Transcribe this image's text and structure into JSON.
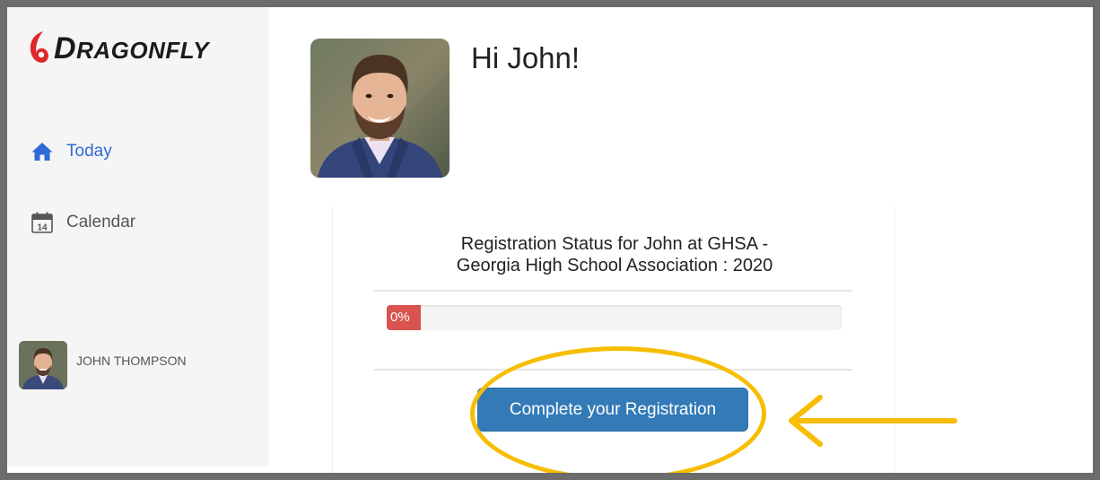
{
  "brand": {
    "logo_text_first": "D",
    "logo_text_rest": "RAGONFLY",
    "accent_color": "#e0262a"
  },
  "sidebar": {
    "items": [
      {
        "label": "Today",
        "icon": "home-icon",
        "active": true,
        "color": "#2f6ad9"
      },
      {
        "label": "Calendar",
        "icon": "calendar-icon",
        "icon_text": "14",
        "active": false
      }
    ],
    "user": {
      "name": "JOHN THOMPSON"
    }
  },
  "main": {
    "greeting": "Hi John!",
    "registration": {
      "title_line1": "Registration Status for John at GHSA -",
      "title_line2": "Georgia High School Association : 2020",
      "progress_label": "0%",
      "progress_value": 0,
      "progress_color": "#d9534f",
      "cta_label": "Complete your Registration",
      "cta_color": "#337ab7"
    }
  },
  "annotation": {
    "highlight_color": "#f7bd00"
  }
}
